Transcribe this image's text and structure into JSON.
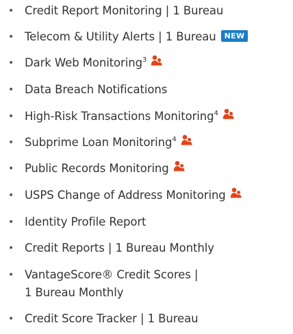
{
  "colors": {
    "text": "#333333",
    "badge_bg": "#1a7dc4",
    "icon": "#e3431b"
  },
  "icon_name": "family-icon",
  "bullet": "•",
  "features": [
    {
      "label": "Credit Report Monitoring | 1 Bureau"
    },
    {
      "label": "Telecom & Utility Alerts | 1 Bureau",
      "badge": "NEW"
    },
    {
      "label": "Dark Web Monitoring",
      "sup": "3",
      "icon": true
    },
    {
      "label": "Data Breach Notifications"
    },
    {
      "label": "High-Risk Transactions Monitoring",
      "sup": "4",
      "icon": true
    },
    {
      "label": "Subprime Loan Monitoring",
      "sup": "4",
      "icon": true
    },
    {
      "label": "Public Records Monitoring",
      "icon": true
    },
    {
      "label": "USPS Change of Address Monitoring",
      "icon": true
    },
    {
      "label": "Identity Profile Report"
    },
    {
      "label": "Credit Reports | 1 Bureau Monthly"
    },
    {
      "label": "VantageScore® Credit Scores |",
      "label_line2": "1 Bureau Monthly"
    },
    {
      "label": "Credit Score Tracker | 1 Bureau"
    }
  ]
}
